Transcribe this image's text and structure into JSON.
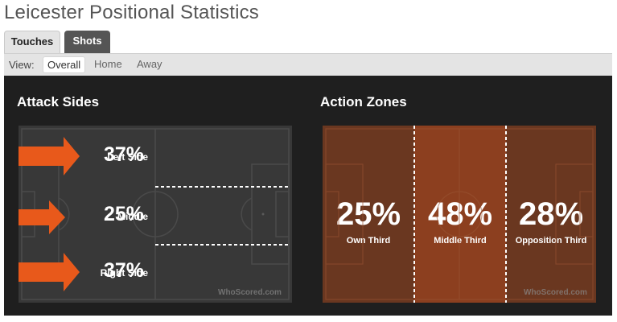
{
  "page": {
    "title": "Leicester Positional Statistics"
  },
  "tabs": [
    {
      "label": "Touches",
      "active": true
    },
    {
      "label": "Shots",
      "active": false
    }
  ],
  "view": {
    "label": "View:",
    "options": [
      "Overall",
      "Home",
      "Away"
    ],
    "selected": "Overall"
  },
  "attack_sides": {
    "title": "Attack Sides",
    "rows": [
      {
        "label": "Left Side",
        "value": "37%"
      },
      {
        "label": "Middle",
        "value": "25%"
      },
      {
        "label": "Right Side",
        "value": "37%"
      }
    ]
  },
  "action_zones": {
    "title": "Action Zones",
    "zones": [
      {
        "label": "Own Third",
        "value": "25%"
      },
      {
        "label": "Middle Third",
        "value": "48%"
      },
      {
        "label": "Opposition Third",
        "value": "28%"
      }
    ]
  },
  "watermark": "WhoScored.com",
  "colors": {
    "panel": "#1f1f1f",
    "pitch": "#383838",
    "arrow": "#e8591b",
    "zone_dark": "#6a3720",
    "zone_mid": "#8c3f1f"
  },
  "icons": [
    "right-arrow-icon",
    "whoscored-logo-icon"
  ]
}
